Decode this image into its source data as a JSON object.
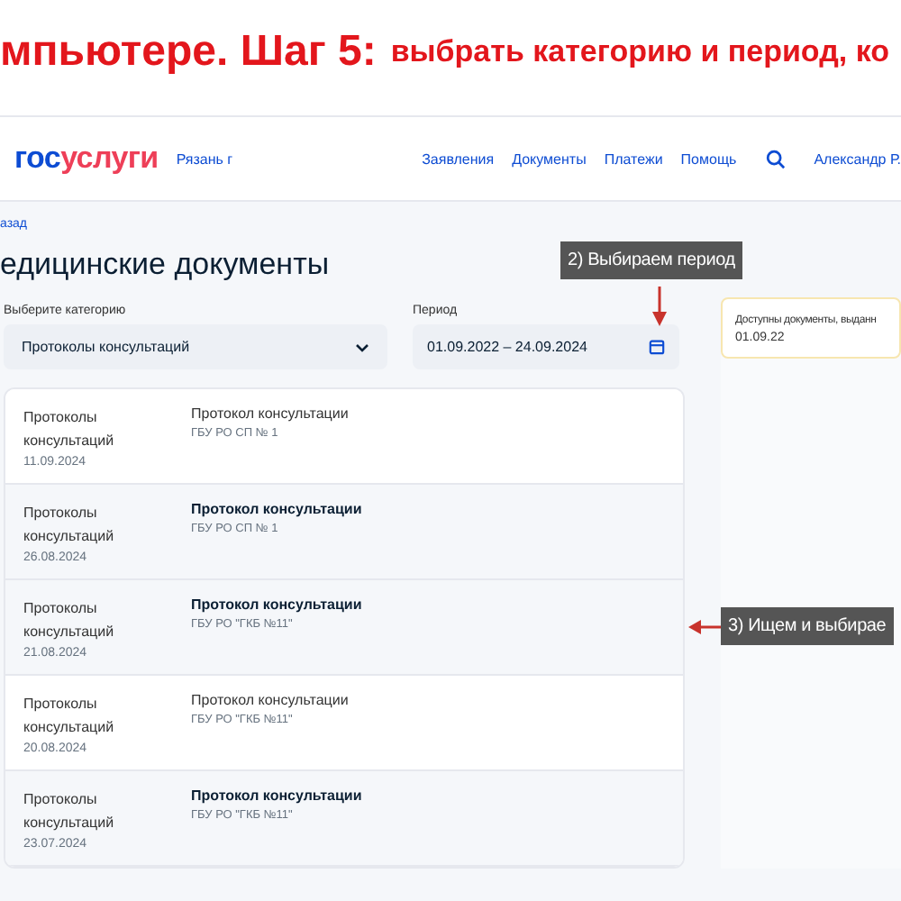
{
  "slide_title": {
    "lead": "мпьютере. Шаг 5:",
    "rest": "выбрать категорию и период, ко"
  },
  "header": {
    "logo_first": "гос",
    "logo_second": "услуги",
    "region": "Рязань г",
    "nav": [
      "Заявления",
      "Документы",
      "Платежи",
      "Помощь"
    ],
    "user": "Александр Р."
  },
  "back_link": "азад",
  "heading": "едицинские документы",
  "category": {
    "label": "Выберите категорию",
    "value": "Протоколы консультаций"
  },
  "period": {
    "label": "Период",
    "value": "01.09.2022 – 24.09.2024"
  },
  "documents": [
    {
      "category": "Протоколы консультаций",
      "date": "11.09.2024",
      "title": "Протокол консультации",
      "org": "ГБУ РО СП № 1",
      "unread": false
    },
    {
      "category": "Протоколы консультаций",
      "date": "26.08.2024",
      "title": "Протокол консультации",
      "org": "ГБУ РО СП № 1",
      "unread": true
    },
    {
      "category": "Протоколы консультаций",
      "date": "21.08.2024",
      "title": "Протокол консультации",
      "org": "ГБУ РО \"ГКБ №11\"",
      "unread": true
    },
    {
      "category": "Протоколы консультаций",
      "date": "20.08.2024",
      "title": "Протокол консультации",
      "org": "ГБУ РО \"ГКБ №11\"",
      "unread": false
    },
    {
      "category": "Протоколы консультаций",
      "date": "23.07.2024",
      "title": "Протокол консультации",
      "org": "ГБУ РО \"ГКБ №11\"",
      "unread": true
    }
  ],
  "info_card": {
    "text": "Доступны документы, выданн",
    "date": "01.09.22"
  },
  "callouts": [
    "2) Выбираем период",
    "3) Ищем и выбирае"
  ]
}
